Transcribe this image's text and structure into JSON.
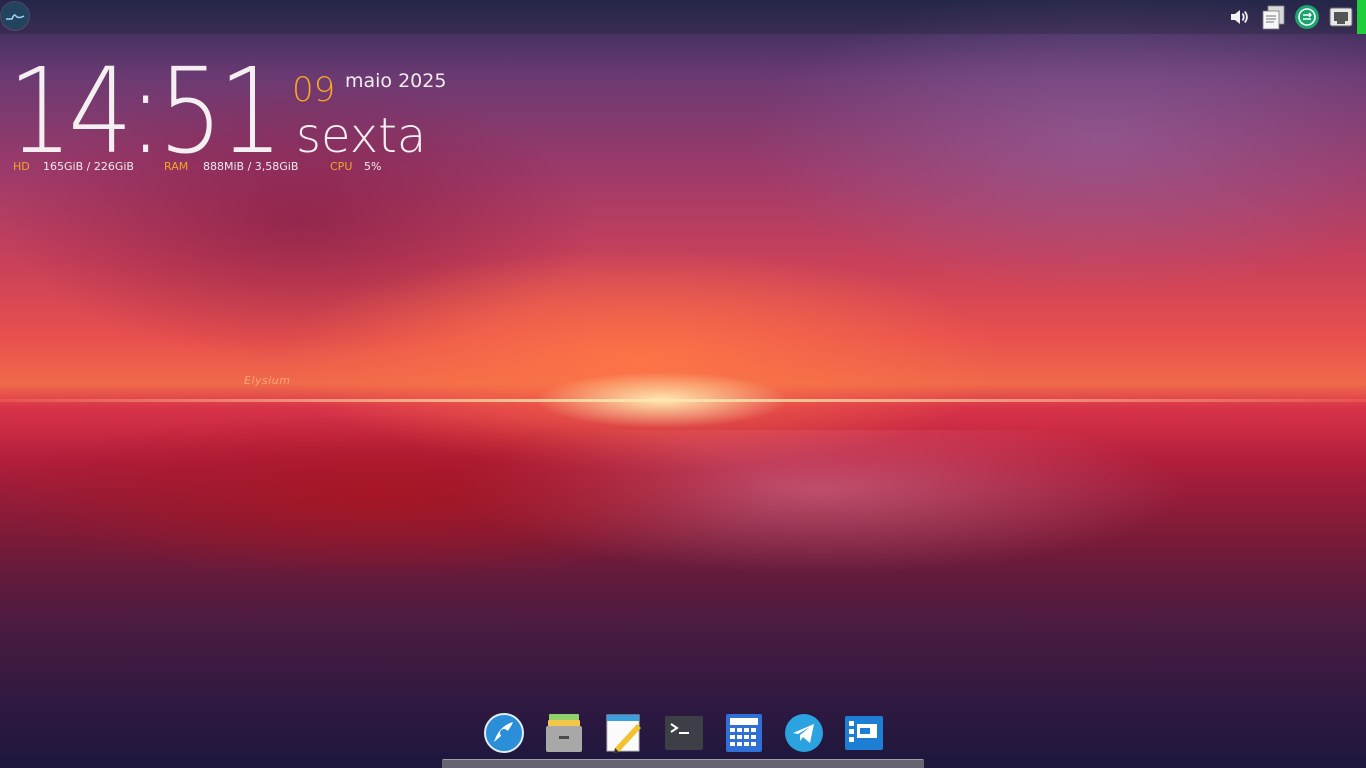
{
  "clock": {
    "time": "14:51",
    "day": "09",
    "month_year": "maio 2025",
    "weekday": "sexta"
  },
  "sysinfo": {
    "hd_label": "HD",
    "hd_value": "165GiB / 226GiB",
    "ram_label": "RAM",
    "ram_value": "888MiB / 3,58GiB",
    "cpu_label": "CPU",
    "cpu_value": "5%"
  },
  "watermark": "Elysium",
  "top_panel": {
    "launcher_icon": "distro-logo-icon",
    "tray": [
      "volume-icon",
      "clipboard-icon",
      "sync-icon",
      "network-wired-icon"
    ]
  },
  "dock": {
    "items": [
      {
        "name": "web-browser-icon"
      },
      {
        "name": "file-manager-icon"
      },
      {
        "name": "text-editor-icon"
      },
      {
        "name": "terminal-icon"
      },
      {
        "name": "calculator-icon"
      },
      {
        "name": "telegram-icon"
      },
      {
        "name": "window-switcher-icon"
      }
    ]
  },
  "colors": {
    "accent_orange": "#f5a623",
    "tray_indicator": "#1fce3a",
    "text": "#f4f0f2"
  }
}
